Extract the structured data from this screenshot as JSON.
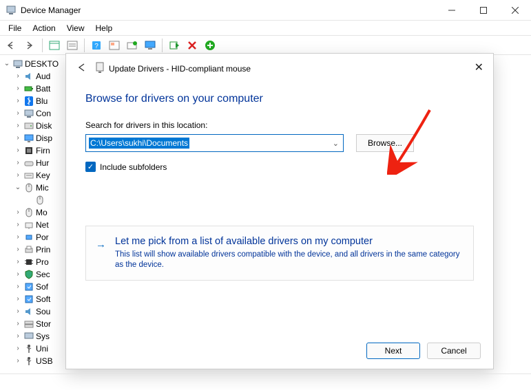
{
  "window": {
    "title": "Device Manager"
  },
  "menu": {
    "file": "File",
    "action": "Action",
    "view": "View",
    "help": "Help"
  },
  "tree": {
    "root": "DESKTO",
    "items": [
      "Aud",
      "Batt",
      "Blu",
      "Con",
      "Disk",
      "Disp",
      "Firn",
      "Hur",
      "Key",
      "Mic",
      "",
      "Mo",
      "Net",
      "Por",
      "Prin",
      "Pro",
      "Sec",
      "Sof",
      "Soft",
      "Sou",
      "Stor",
      "Sys",
      "Uni",
      "USB"
    ],
    "micExpanded": true
  },
  "dialog": {
    "title": "Update Drivers - HID-compliant mouse",
    "heading": "Browse for drivers on your computer",
    "locationLabel": "Search for drivers in this location:",
    "path": "C:\\Users\\sukhi\\Documents",
    "browse": "Browse...",
    "includeSub": "Include subfolders",
    "optionTitle": "Let me pick from a list of available drivers on my computer",
    "optionDesc": "This list will show available drivers compatible with the device, and all drivers in the same category as the device.",
    "next": "Next",
    "cancel": "Cancel"
  }
}
